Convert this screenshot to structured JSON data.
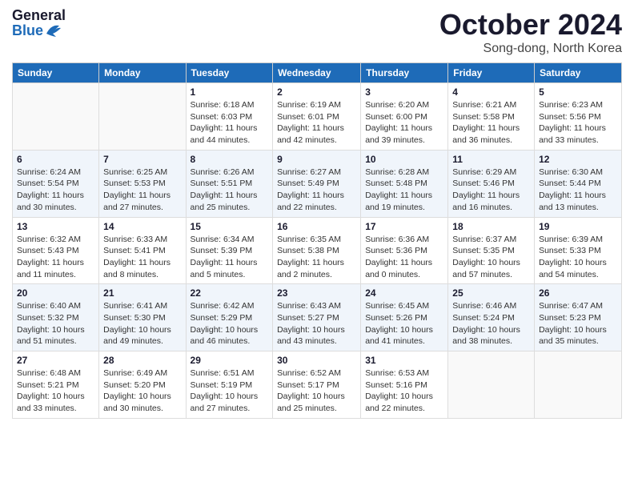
{
  "header": {
    "logo_general": "General",
    "logo_blue": "Blue",
    "month_title": "October 2024",
    "location": "Song-dong, North Korea"
  },
  "weekdays": [
    "Sunday",
    "Monday",
    "Tuesday",
    "Wednesday",
    "Thursday",
    "Friday",
    "Saturday"
  ],
  "weeks": [
    [
      {
        "day": "",
        "info": ""
      },
      {
        "day": "",
        "info": ""
      },
      {
        "day": "1",
        "sunrise": "Sunrise: 6:18 AM",
        "sunset": "Sunset: 6:03 PM",
        "daylight": "Daylight: 11 hours and 44 minutes."
      },
      {
        "day": "2",
        "sunrise": "Sunrise: 6:19 AM",
        "sunset": "Sunset: 6:01 PM",
        "daylight": "Daylight: 11 hours and 42 minutes."
      },
      {
        "day": "3",
        "sunrise": "Sunrise: 6:20 AM",
        "sunset": "Sunset: 6:00 PM",
        "daylight": "Daylight: 11 hours and 39 minutes."
      },
      {
        "day": "4",
        "sunrise": "Sunrise: 6:21 AM",
        "sunset": "Sunset: 5:58 PM",
        "daylight": "Daylight: 11 hours and 36 minutes."
      },
      {
        "day": "5",
        "sunrise": "Sunrise: 6:23 AM",
        "sunset": "Sunset: 5:56 PM",
        "daylight": "Daylight: 11 hours and 33 minutes."
      }
    ],
    [
      {
        "day": "6",
        "sunrise": "Sunrise: 6:24 AM",
        "sunset": "Sunset: 5:54 PM",
        "daylight": "Daylight: 11 hours and 30 minutes."
      },
      {
        "day": "7",
        "sunrise": "Sunrise: 6:25 AM",
        "sunset": "Sunset: 5:53 PM",
        "daylight": "Daylight: 11 hours and 27 minutes."
      },
      {
        "day": "8",
        "sunrise": "Sunrise: 6:26 AM",
        "sunset": "Sunset: 5:51 PM",
        "daylight": "Daylight: 11 hours and 25 minutes."
      },
      {
        "day": "9",
        "sunrise": "Sunrise: 6:27 AM",
        "sunset": "Sunset: 5:49 PM",
        "daylight": "Daylight: 11 hours and 22 minutes."
      },
      {
        "day": "10",
        "sunrise": "Sunrise: 6:28 AM",
        "sunset": "Sunset: 5:48 PM",
        "daylight": "Daylight: 11 hours and 19 minutes."
      },
      {
        "day": "11",
        "sunrise": "Sunrise: 6:29 AM",
        "sunset": "Sunset: 5:46 PM",
        "daylight": "Daylight: 11 hours and 16 minutes."
      },
      {
        "day": "12",
        "sunrise": "Sunrise: 6:30 AM",
        "sunset": "Sunset: 5:44 PM",
        "daylight": "Daylight: 11 hours and 13 minutes."
      }
    ],
    [
      {
        "day": "13",
        "sunrise": "Sunrise: 6:32 AM",
        "sunset": "Sunset: 5:43 PM",
        "daylight": "Daylight: 11 hours and 11 minutes."
      },
      {
        "day": "14",
        "sunrise": "Sunrise: 6:33 AM",
        "sunset": "Sunset: 5:41 PM",
        "daylight": "Daylight: 11 hours and 8 minutes."
      },
      {
        "day": "15",
        "sunrise": "Sunrise: 6:34 AM",
        "sunset": "Sunset: 5:39 PM",
        "daylight": "Daylight: 11 hours and 5 minutes."
      },
      {
        "day": "16",
        "sunrise": "Sunrise: 6:35 AM",
        "sunset": "Sunset: 5:38 PM",
        "daylight": "Daylight: 11 hours and 2 minutes."
      },
      {
        "day": "17",
        "sunrise": "Sunrise: 6:36 AM",
        "sunset": "Sunset: 5:36 PM",
        "daylight": "Daylight: 11 hours and 0 minutes."
      },
      {
        "day": "18",
        "sunrise": "Sunrise: 6:37 AM",
        "sunset": "Sunset: 5:35 PM",
        "daylight": "Daylight: 10 hours and 57 minutes."
      },
      {
        "day": "19",
        "sunrise": "Sunrise: 6:39 AM",
        "sunset": "Sunset: 5:33 PM",
        "daylight": "Daylight: 10 hours and 54 minutes."
      }
    ],
    [
      {
        "day": "20",
        "sunrise": "Sunrise: 6:40 AM",
        "sunset": "Sunset: 5:32 PM",
        "daylight": "Daylight: 10 hours and 51 minutes."
      },
      {
        "day": "21",
        "sunrise": "Sunrise: 6:41 AM",
        "sunset": "Sunset: 5:30 PM",
        "daylight": "Daylight: 10 hours and 49 minutes."
      },
      {
        "day": "22",
        "sunrise": "Sunrise: 6:42 AM",
        "sunset": "Sunset: 5:29 PM",
        "daylight": "Daylight: 10 hours and 46 minutes."
      },
      {
        "day": "23",
        "sunrise": "Sunrise: 6:43 AM",
        "sunset": "Sunset: 5:27 PM",
        "daylight": "Daylight: 10 hours and 43 minutes."
      },
      {
        "day": "24",
        "sunrise": "Sunrise: 6:45 AM",
        "sunset": "Sunset: 5:26 PM",
        "daylight": "Daylight: 10 hours and 41 minutes."
      },
      {
        "day": "25",
        "sunrise": "Sunrise: 6:46 AM",
        "sunset": "Sunset: 5:24 PM",
        "daylight": "Daylight: 10 hours and 38 minutes."
      },
      {
        "day": "26",
        "sunrise": "Sunrise: 6:47 AM",
        "sunset": "Sunset: 5:23 PM",
        "daylight": "Daylight: 10 hours and 35 minutes."
      }
    ],
    [
      {
        "day": "27",
        "sunrise": "Sunrise: 6:48 AM",
        "sunset": "Sunset: 5:21 PM",
        "daylight": "Daylight: 10 hours and 33 minutes."
      },
      {
        "day": "28",
        "sunrise": "Sunrise: 6:49 AM",
        "sunset": "Sunset: 5:20 PM",
        "daylight": "Daylight: 10 hours and 30 minutes."
      },
      {
        "day": "29",
        "sunrise": "Sunrise: 6:51 AM",
        "sunset": "Sunset: 5:19 PM",
        "daylight": "Daylight: 10 hours and 27 minutes."
      },
      {
        "day": "30",
        "sunrise": "Sunrise: 6:52 AM",
        "sunset": "Sunset: 5:17 PM",
        "daylight": "Daylight: 10 hours and 25 minutes."
      },
      {
        "day": "31",
        "sunrise": "Sunrise: 6:53 AM",
        "sunset": "Sunset: 5:16 PM",
        "daylight": "Daylight: 10 hours and 22 minutes."
      },
      {
        "day": "",
        "info": ""
      },
      {
        "day": "",
        "info": ""
      }
    ]
  ]
}
